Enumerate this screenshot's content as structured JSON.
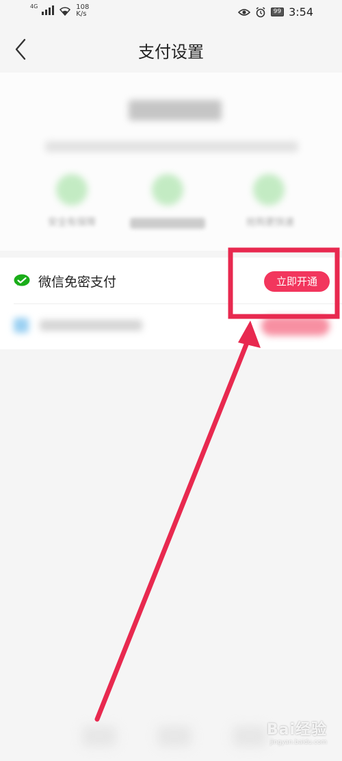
{
  "status_bar": {
    "network_type": "4G",
    "speed_value": "108",
    "speed_unit": "K/s",
    "battery_level": "99",
    "time": "3:54"
  },
  "header": {
    "title": "支付设置",
    "back_icon": "chevron-left-icon"
  },
  "intro": {
    "features": [
      {
        "label": "安全有保障",
        "icon": "shield-icon",
        "blurred": false
      },
      {
        "label": "",
        "icon": "feature-icon",
        "blurred": true
      },
      {
        "label": "抢购更快速",
        "icon": "speed-icon",
        "blurred": false
      }
    ]
  },
  "payment_methods": [
    {
      "icon": "wechat-pay-icon",
      "label": "微信免密支付",
      "button_label": "立即开通"
    }
  ],
  "colors": {
    "accent": "#f2365d",
    "wechat_green": "#1aad19",
    "annotation_red": "#e8294f"
  },
  "watermark": {
    "logo": "Bai经验",
    "url": "jingyan.baidu.com"
  }
}
